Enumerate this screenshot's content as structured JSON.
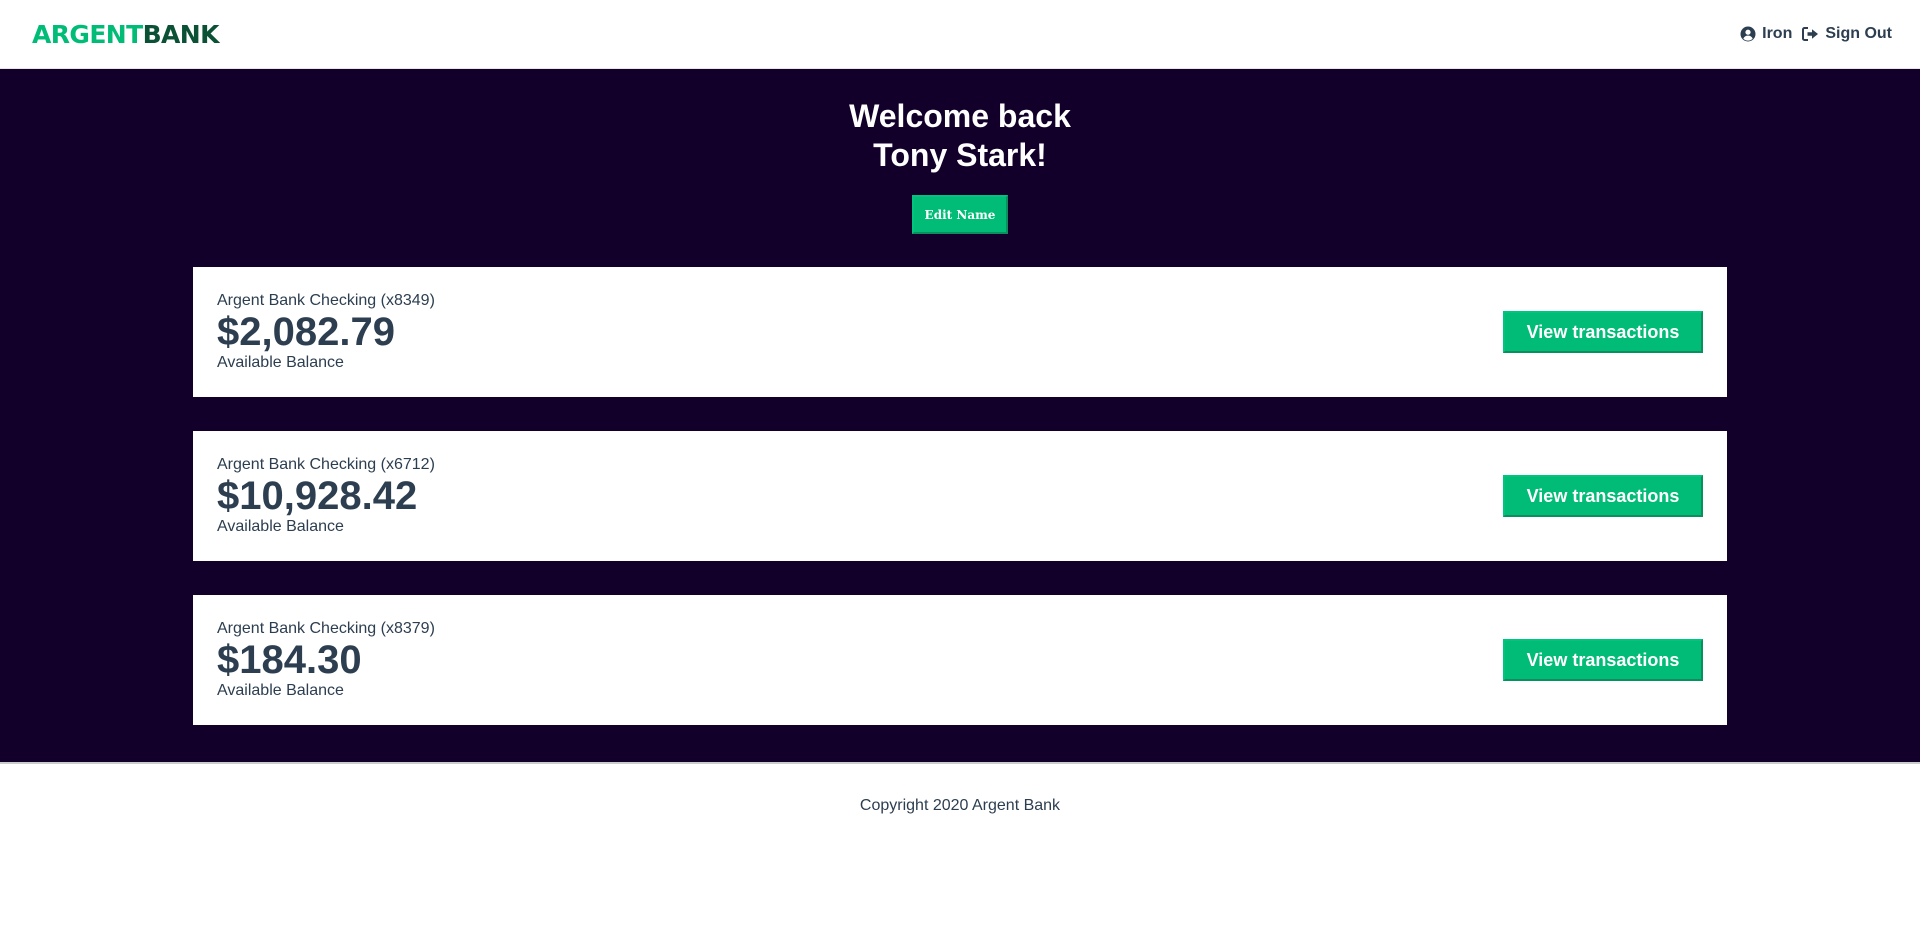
{
  "header": {
    "logo": {
      "part1": "ARGENT",
      "part2": "BANK"
    },
    "user_link_label": "Iron",
    "signout_label": "Sign Out"
  },
  "main": {
    "welcome_line1": "Welcome back",
    "welcome_line2": "Tony Stark!",
    "edit_button_label": "Edit Name"
  },
  "accounts": [
    {
      "title": "Argent Bank Checking (x8349)",
      "amount": "$2,082.79",
      "description": "Available Balance",
      "button_label": "View transactions"
    },
    {
      "title": "Argent Bank Checking (x6712)",
      "amount": "$10,928.42",
      "description": "Available Balance",
      "button_label": "View transactions"
    },
    {
      "title": "Argent Bank Checking (x8379)",
      "amount": "$184.30",
      "description": "Available Balance",
      "button_label": "View transactions"
    }
  ],
  "footer": {
    "text": "Copyright 2020 Argent Bank"
  },
  "colors": {
    "accent": "#00bc77",
    "logo_dark": "#0b5136",
    "main_bg": "#12002b",
    "text": "#2c3e50"
  },
  "icons": {
    "user": "user-circle-icon",
    "signout": "sign-out-icon"
  }
}
